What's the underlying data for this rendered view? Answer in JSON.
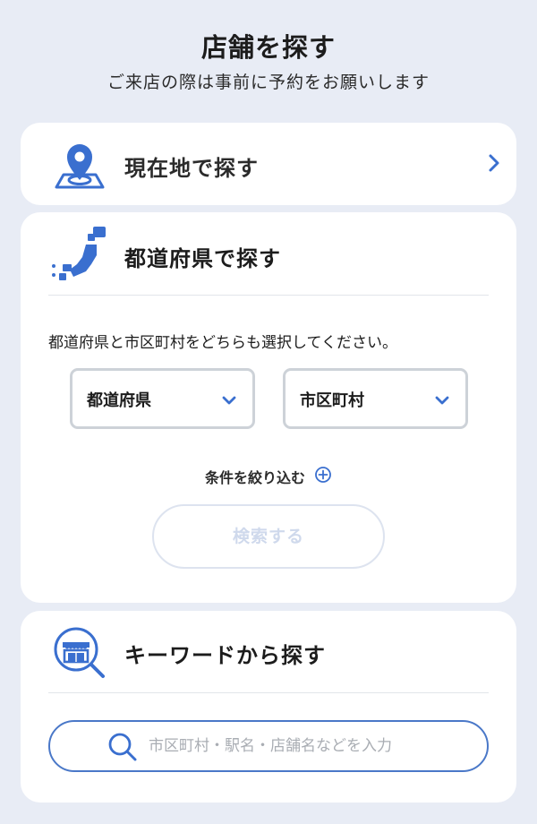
{
  "header": {
    "title": "店舗を探す",
    "subtitle": "ご来店の際は事前に予約をお願いします"
  },
  "current_location": {
    "title": "現在地で探す",
    "icon": "location-pin-icon",
    "chevron_icon": "chevron-right-icon"
  },
  "prefecture": {
    "title": "都道府県で探す",
    "icon": "japan-map-icon",
    "instruction": "都道府県と市区町村をどちらも選択してください。",
    "select_prefecture": "都道府県",
    "select_city": "市区町村",
    "filter_label": "条件を絞り込む",
    "search_button": "検索する"
  },
  "keyword": {
    "title": "キーワードから探す",
    "icon": "store-search-icon",
    "placeholder": "市区町村・駅名・店舗名などを入力",
    "value": ""
  },
  "colors": {
    "accent": "#3a6fcf",
    "background": "#e8ecf5",
    "card": "#ffffff",
    "disabled_text": "#cfd9ec"
  }
}
